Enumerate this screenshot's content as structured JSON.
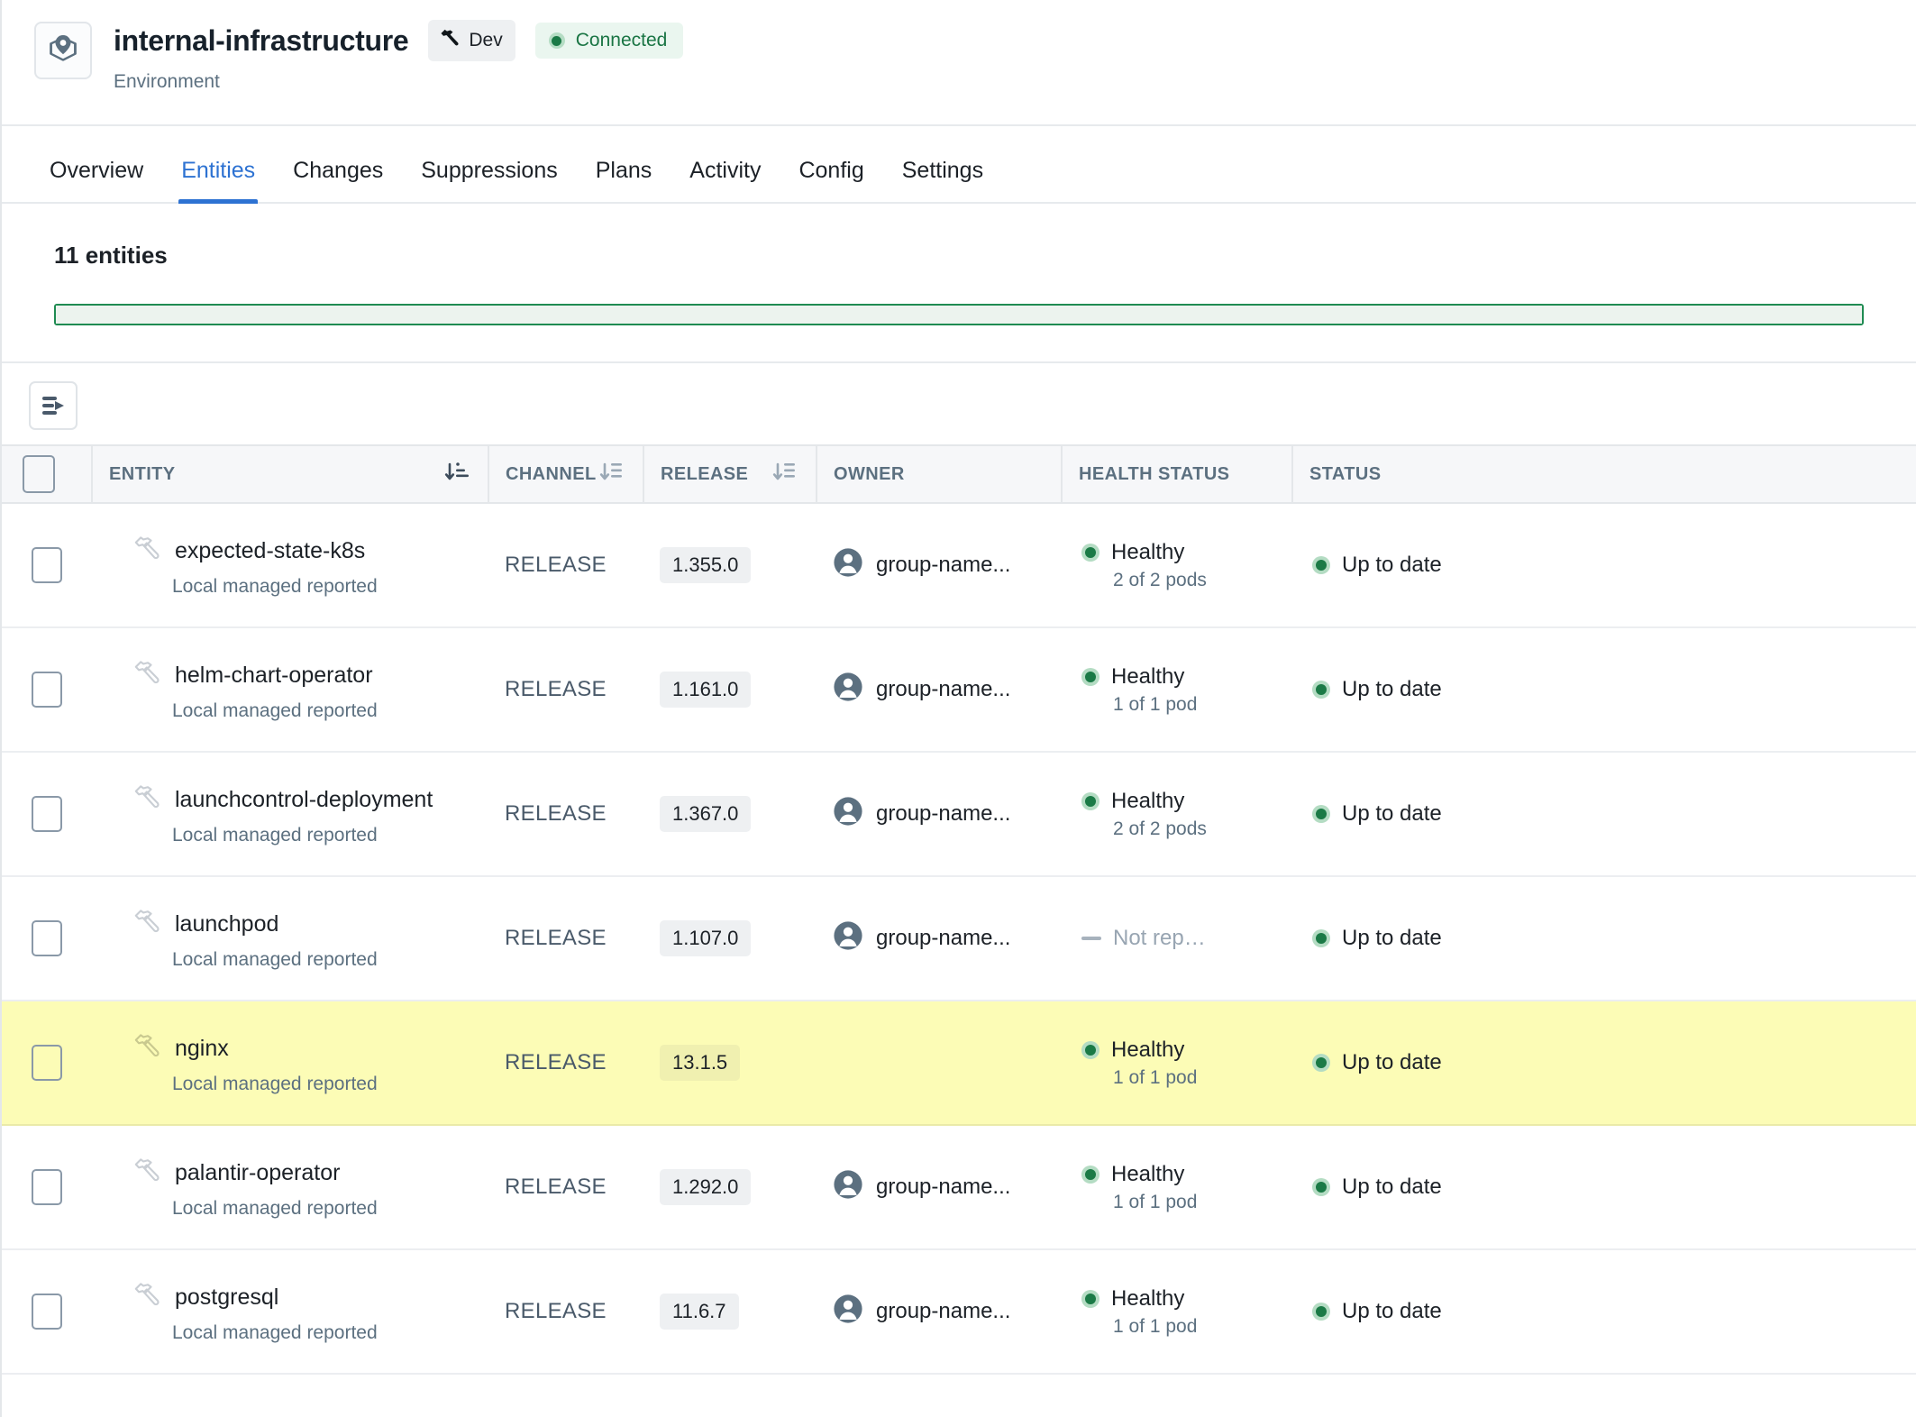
{
  "header": {
    "icon": "environment-pin-icon",
    "title": "internal-infrastructure",
    "subtitle": "Environment",
    "dev_badge": {
      "icon": "hammer-icon",
      "label": "Dev"
    },
    "connection_badge": {
      "icon": "status-dot-icon",
      "label": "Connected",
      "color": "#1a7544"
    }
  },
  "tabs": [
    {
      "label": "Overview",
      "active": false
    },
    {
      "label": "Entities",
      "active": true
    },
    {
      "label": "Changes",
      "active": false
    },
    {
      "label": "Suppressions",
      "active": false
    },
    {
      "label": "Plans",
      "active": false
    },
    {
      "label": "Activity",
      "active": false
    },
    {
      "label": "Config",
      "active": false
    },
    {
      "label": "Settings",
      "active": false
    }
  ],
  "summary": {
    "entity_count_label": "11 entities",
    "progress_percent": 100,
    "progress_border_color": "#1f8b52",
    "progress_fill_color": "#ecf3ee"
  },
  "toolbar": {
    "expand_button_icon": "panel-expand-icon"
  },
  "table": {
    "columns": [
      {
        "key": "entity",
        "label": "ENTITY",
        "sortable": true,
        "sort_active": true
      },
      {
        "key": "channel",
        "label": "CHANNEL",
        "sortable": true,
        "sort_active": false
      },
      {
        "key": "release",
        "label": "RELEASE",
        "sortable": true,
        "sort_active": false
      },
      {
        "key": "owner",
        "label": "OWNER",
        "sortable": false,
        "sort_active": false
      },
      {
        "key": "health",
        "label": "HEALTH STATUS",
        "sortable": false,
        "sort_active": false
      },
      {
        "key": "status",
        "label": "STATUS",
        "sortable": false,
        "sort_active": false
      }
    ],
    "rows": [
      {
        "entity": "expected-state-k8s",
        "entity_sub": "Local managed reported",
        "entity_icon": "hammer-icon",
        "channel": "RELEASE",
        "release": "1.355.0",
        "owner": "group-name...",
        "owner_avatar": "person-avatar-icon",
        "health": "Healthy",
        "health_sub": "2 of 2 pods",
        "health_state": "healthy",
        "status": "Up to date",
        "status_state": "healthy",
        "highlighted": false
      },
      {
        "entity": "helm-chart-operator",
        "entity_sub": "Local managed reported",
        "entity_icon": "hammer-icon",
        "channel": "RELEASE",
        "release": "1.161.0",
        "owner": "group-name...",
        "owner_avatar": "person-avatar-icon",
        "health": "Healthy",
        "health_sub": "1 of 1 pod",
        "health_state": "healthy",
        "status": "Up to date",
        "status_state": "healthy",
        "highlighted": false
      },
      {
        "entity": "launchcontrol-deployment",
        "entity_sub": "Local managed reported",
        "entity_icon": "hammer-icon",
        "channel": "RELEASE",
        "release": "1.367.0",
        "owner": "group-name...",
        "owner_avatar": "person-avatar-icon",
        "health": "Healthy",
        "health_sub": "2 of 2 pods",
        "health_state": "healthy",
        "status": "Up to date",
        "status_state": "healthy",
        "highlighted": false
      },
      {
        "entity": "launchpod",
        "entity_sub": "Local managed reported",
        "entity_icon": "hammer-icon",
        "channel": "RELEASE",
        "release": "1.107.0",
        "owner": "group-name...",
        "owner_avatar": "person-avatar-icon",
        "health": "Not rep…",
        "health_sub": "",
        "health_state": "none",
        "status": "Up to date",
        "status_state": "healthy",
        "highlighted": false
      },
      {
        "entity": "nginx",
        "entity_sub": "Local managed reported",
        "entity_icon": "hammer-icon",
        "channel": "RELEASE",
        "release": "13.1.5",
        "owner": "",
        "owner_avatar": "",
        "health": "Healthy",
        "health_sub": "1 of 1 pod",
        "health_state": "healthy",
        "status": "Up to date",
        "status_state": "healthy",
        "highlighted": true
      },
      {
        "entity": "palantir-operator",
        "entity_sub": "Local managed reported",
        "entity_icon": "hammer-icon",
        "channel": "RELEASE",
        "release": "1.292.0",
        "owner": "group-name...",
        "owner_avatar": "person-avatar-icon",
        "health": "Healthy",
        "health_sub": "1 of 1 pod",
        "health_state": "healthy",
        "status": "Up to date",
        "status_state": "healthy",
        "highlighted": false
      },
      {
        "entity": "postgresql",
        "entity_sub": "Local managed reported",
        "entity_icon": "hammer-icon",
        "channel": "RELEASE",
        "release": "11.6.7",
        "owner": "group-name...",
        "owner_avatar": "person-avatar-icon",
        "health": "Healthy",
        "health_sub": "1 of 1 pod",
        "health_state": "healthy",
        "status": "Up to date",
        "status_state": "healthy",
        "highlighted": false
      }
    ]
  },
  "colors": {
    "accent": "#2d72d2",
    "healthy_green": "#1b7a46",
    "highlight_yellow": "#fcfcb6",
    "muted_text": "#5c7080"
  }
}
